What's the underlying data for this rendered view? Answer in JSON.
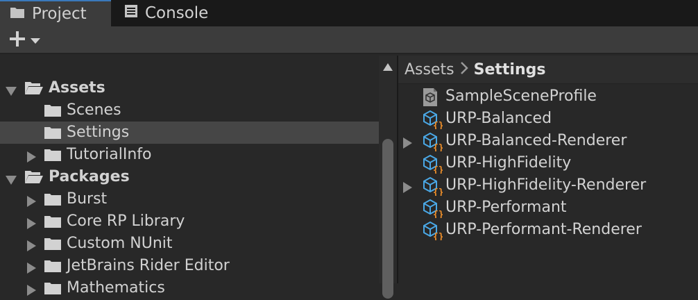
{
  "tabs": {
    "project_label": "Project",
    "console_label": "Console"
  },
  "tree": {
    "items": [
      {
        "label": "Assets",
        "bold": true
      },
      {
        "label": "Scenes"
      },
      {
        "label": "Settings"
      },
      {
        "label": "TutorialInfo"
      },
      {
        "label": "Packages",
        "bold": true
      },
      {
        "label": "Burst"
      },
      {
        "label": "Core RP Library"
      },
      {
        "label": "Custom NUnit"
      },
      {
        "label": "JetBrains Rider Editor"
      },
      {
        "label": "Mathematics"
      }
    ]
  },
  "breadcrumb": {
    "root": "Assets",
    "current": "Settings"
  },
  "assets": {
    "items": [
      {
        "label": "SampleSceneProfile",
        "icon": "volume-profile-icon"
      },
      {
        "label": "URP-Balanced",
        "icon": "render-pipeline-asset-icon"
      },
      {
        "label": "URP-Balanced-Renderer",
        "icon": "render-pipeline-asset-icon"
      },
      {
        "label": "URP-HighFidelity",
        "icon": "render-pipeline-asset-icon"
      },
      {
        "label": "URP-HighFidelity-Renderer",
        "icon": "render-pipeline-asset-icon"
      },
      {
        "label": "URP-Performant",
        "icon": "render-pipeline-asset-icon"
      },
      {
        "label": "URP-Performant-Renderer",
        "icon": "render-pipeline-asset-icon"
      }
    ]
  },
  "colors": {
    "active_tab_accent": "#3a79bb",
    "selected_row": "#464646",
    "asset_icon_blue": "#4aa8e6",
    "asset_icon_orange": "#f0902a"
  }
}
